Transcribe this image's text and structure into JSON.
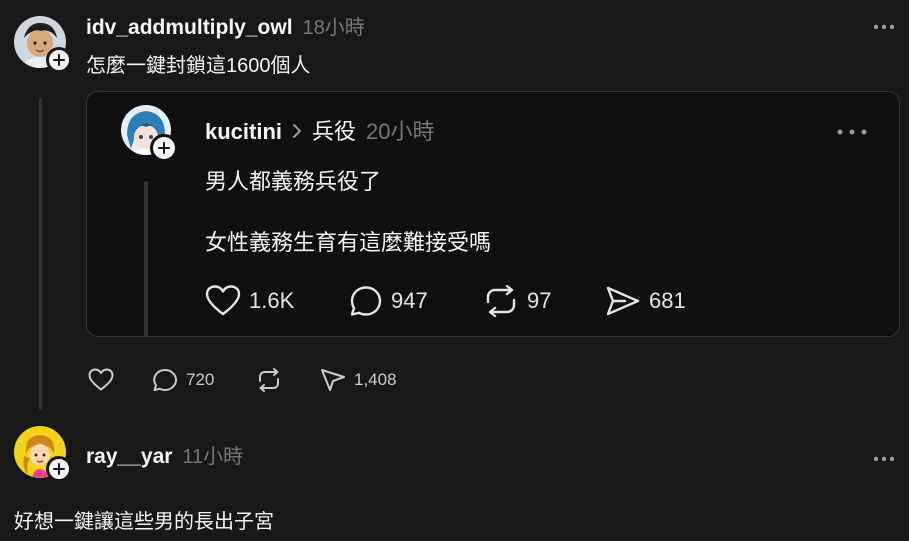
{
  "post1": {
    "username": "idv_addmultiply_owl",
    "time": "18小時",
    "text": "怎麼一鍵封鎖這1600個人",
    "avatar_icon": "avatar-anime-boy",
    "actions": {
      "like": "",
      "reply": "720",
      "repost": "",
      "share": "1,408"
    }
  },
  "quoted": {
    "username": "kucitini",
    "topic": "兵役",
    "time": "20小時",
    "line1": "男人都義務兵役了",
    "line2": "女性義務生育有這麼難接受嗎",
    "avatar_icon": "avatar-anime-bluehair",
    "actions": {
      "like": "1.6K",
      "reply": "947",
      "repost": "97",
      "share": "681"
    }
  },
  "post2": {
    "username": "ray__yar",
    "time": "11小時",
    "text": "好想一鍵讓這些男的長出子宮",
    "avatar_icon": "avatar-yellow-cartoon"
  },
  "colors": {
    "background": "#181818",
    "card": "#101010",
    "border": "#333333",
    "muted": "#777777"
  }
}
